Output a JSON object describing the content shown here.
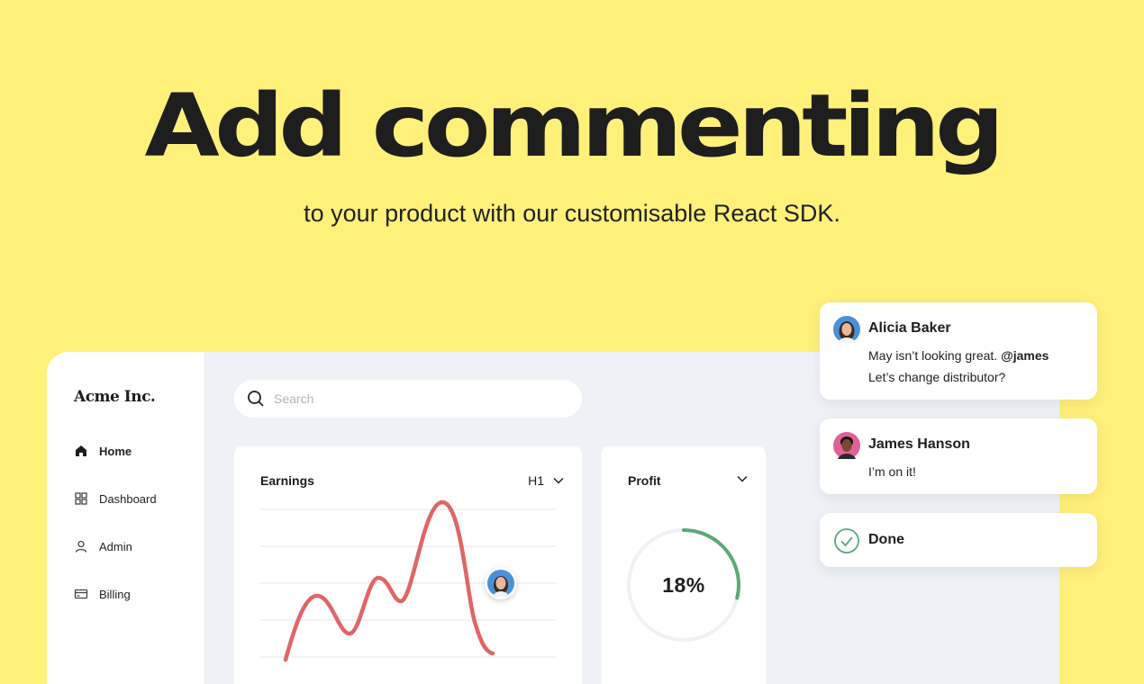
{
  "hero": {
    "title": "Add commenting",
    "subtitle": "to your product with our customisable React SDK."
  },
  "app": {
    "brand": "Acme Inc.",
    "nav": [
      {
        "label": "Home",
        "icon": "home-icon",
        "active": true
      },
      {
        "label": "Dashboard",
        "icon": "grid-icon",
        "active": false
      },
      {
        "label": "Admin",
        "icon": "user-icon",
        "active": false
      },
      {
        "label": "Billing",
        "icon": "card-icon",
        "active": false
      }
    ],
    "search": {
      "placeholder": "Search",
      "value": ""
    },
    "earnings": {
      "title": "Earnings",
      "period": "H1"
    },
    "profit": {
      "title": "Profit",
      "percent_label": "18%",
      "percent": 18
    }
  },
  "comments": [
    {
      "author": "Alicia Baker",
      "text_1": "May isn’t looking great. ",
      "mention": "@james",
      "text_2": "Let’s change distributor?"
    },
    {
      "author": "James Hanson",
      "text_1": "I’m on it!"
    }
  ],
  "done": {
    "label": "Done"
  },
  "colors": {
    "background": "#fff07a",
    "chart_line": "#e06666",
    "donut_progress": "#5aaa78",
    "donut_track": "#eef1f5"
  }
}
